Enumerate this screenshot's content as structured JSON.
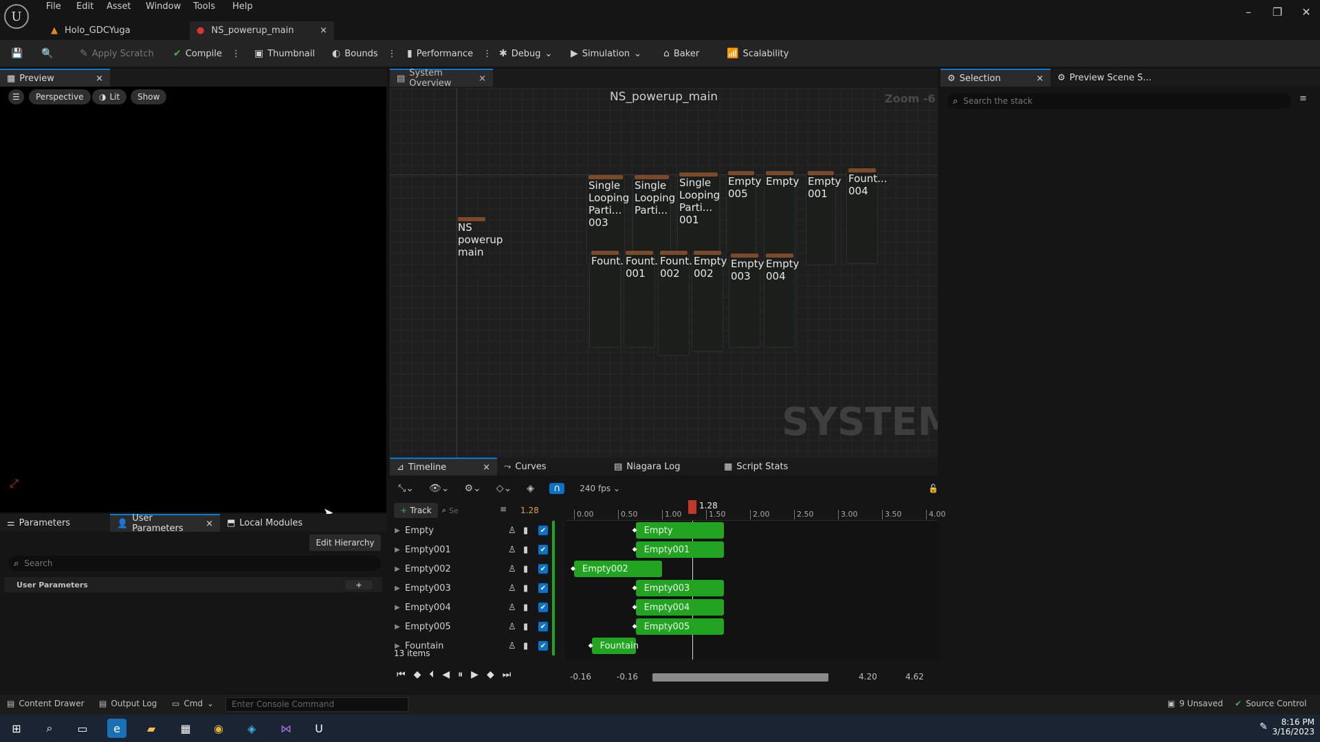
{
  "menu": [
    "File",
    "Edit",
    "Asset",
    "Window",
    "Tools",
    "Help"
  ],
  "doc_tabs": [
    {
      "label": "Holo_GDCYuga"
    },
    {
      "label": "NS_powerup_main"
    }
  ],
  "toolbar": {
    "apply_scratch": "Apply Scratch",
    "compile": "Compile",
    "thumbnail": "Thumbnail",
    "bounds": "Bounds",
    "performance": "Performance",
    "debug": "Debug",
    "simulation": "Simulation",
    "baker": "Baker",
    "scalability": "Scalability"
  },
  "preview": {
    "tab": "Preview",
    "perspective": "Perspective",
    "lit": "Lit",
    "show": "Show"
  },
  "system_overview": {
    "tab": "System Overview",
    "title": "NS_powerup_main",
    "zoom": "Zoom -6",
    "watermark": "SYSTEM",
    "system_node": [
      "NS",
      "powerup",
      "main"
    ],
    "emitters_top": [
      {
        "lines": [
          "Single",
          "Looping",
          "Parti...",
          "003"
        ]
      },
      {
        "lines": [
          "Single",
          "Looping",
          "Parti..."
        ]
      },
      {
        "lines": [
          "Single",
          "Looping",
          "Parti...",
          "001"
        ]
      },
      {
        "lines": [
          "Empty",
          "005"
        ]
      },
      {
        "lines": [
          "Empty"
        ]
      },
      {
        "lines": [
          "Empty",
          "001"
        ]
      },
      {
        "lines": [
          "Fount...",
          "004"
        ]
      }
    ],
    "emitters_bottom": [
      {
        "lines": [
          "Fount..."
        ]
      },
      {
        "lines": [
          "Fount...",
          "001"
        ]
      },
      {
        "lines": [
          "Fount...",
          "002"
        ]
      },
      {
        "lines": [
          "Empty",
          "002"
        ]
      },
      {
        "lines": [
          "Empty",
          "003"
        ]
      },
      {
        "lines": [
          "Empty",
          "004"
        ]
      }
    ]
  },
  "selection": {
    "tab": "Selection",
    "tab2": "Preview Scene S...",
    "search_placeholder": "Search the stack"
  },
  "parameters": {
    "tab1": "Parameters",
    "tab2": "User Parameters",
    "tab3": "Local Modules",
    "edit_hierarchy": "Edit Hierarchy",
    "search_placeholder": "Search",
    "section": "User Parameters"
  },
  "timeline": {
    "tabs": [
      "Timeline",
      "Curves",
      "Niagara Log",
      "Script Stats"
    ],
    "fps": "240 fps",
    "track_button": "Track",
    "search_placeholder": "Se",
    "current_time": "1.28",
    "playhead": "1.28",
    "ticks": [
      "0.00",
      "0.50",
      "1.00",
      "1.50",
      "2.00",
      "2.50",
      "3.00",
      "3.50",
      "4.00"
    ],
    "tracks": [
      "Empty",
      "Empty001",
      "Empty002",
      "Empty003",
      "Empty004",
      "Empty005",
      "Fountain"
    ],
    "bars": [
      {
        "label": "Empty",
        "start": 0.7,
        "end": 1.7
      },
      {
        "label": "Empty001",
        "start": 0.7,
        "end": 1.7
      },
      {
        "label": "Empty002",
        "start": 0.0,
        "end": 1.0
      },
      {
        "label": "Empty003",
        "start": 0.7,
        "end": 1.7
      },
      {
        "label": "Empty004",
        "start": 0.7,
        "end": 1.7
      },
      {
        "label": "Empty005",
        "start": 0.7,
        "end": 1.7
      },
      {
        "label": "Fountain",
        "start": 0.2,
        "end": 0.7
      }
    ],
    "items_count": "13 items",
    "range_start": "-0.16",
    "range_start2": "-0.16",
    "range_end": "4.20",
    "range_end2": "4.62"
  },
  "status": {
    "content_drawer": "Content Drawer",
    "output_log": "Output Log",
    "cmd": "Cmd",
    "console_placeholder": "Enter Console Command",
    "unsaved": "9 Unsaved",
    "source_control": "Source Control"
  },
  "taskbar": {
    "time": "8:16 PM",
    "date": "3/16/2023"
  }
}
